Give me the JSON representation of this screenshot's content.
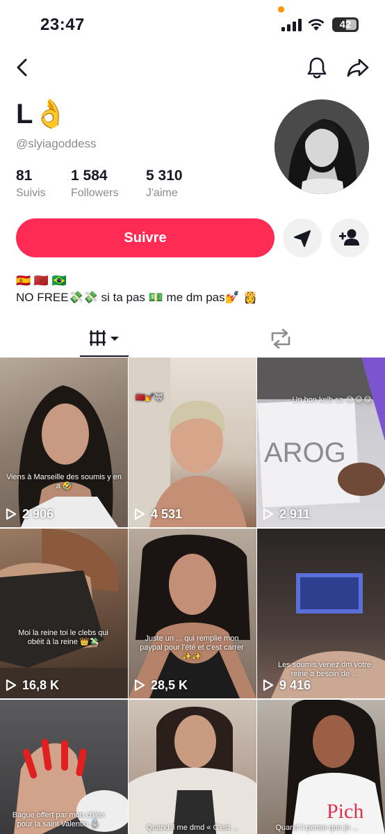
{
  "status_bar": {
    "time": "23:47",
    "battery": "42"
  },
  "profile": {
    "name": "L",
    "name_emoji": "👌",
    "handle": "@slyiagoddess"
  },
  "stats": [
    {
      "value": "81",
      "label": "Suivis"
    },
    {
      "value": "1 584",
      "label": "Followers"
    },
    {
      "value": "5 310",
      "label": "J'aime"
    }
  ],
  "actions": {
    "follow_label": "Suivre"
  },
  "bio": {
    "flags": "🇪🇸 🇲🇦 🇧🇷",
    "text": "NO FREE💸💸 si ta pas 💵 me dm pas💅 👸"
  },
  "colors": {
    "accent": "#fe2c55",
    "text": "#161823",
    "muted": "#8a8b91"
  },
  "videos": [
    {
      "views": "2 906",
      "caption": "Viens à Marseille des soumis y en a 🤣"
    },
    {
      "views": "4 531",
      "caption": "🇲🇦💅🐺"
    },
    {
      "views": "2 911",
      "caption": "Un bon kelb sa 😂😂😂"
    },
    {
      "views": "16,8 K",
      "caption": "Moi la reine toi le clebs qui obéit à la reine 👑💸"
    },
    {
      "views": "28,5 K",
      "caption": "Juste un ... qui remplie mon paypal pour l'été et c'est carrer ✨✨"
    },
    {
      "views": "9 416",
      "caption": "Les soumis venez dm votre reine a besoin de ..."
    },
    {
      "views": "",
      "caption": "Bague offert par mon chien pour la saint Valentin 💍"
    },
    {
      "views": "",
      "caption": "Quand il me dmd « C'est ..."
    },
    {
      "views": "",
      "caption": "Quand il pense que je ..."
    }
  ]
}
